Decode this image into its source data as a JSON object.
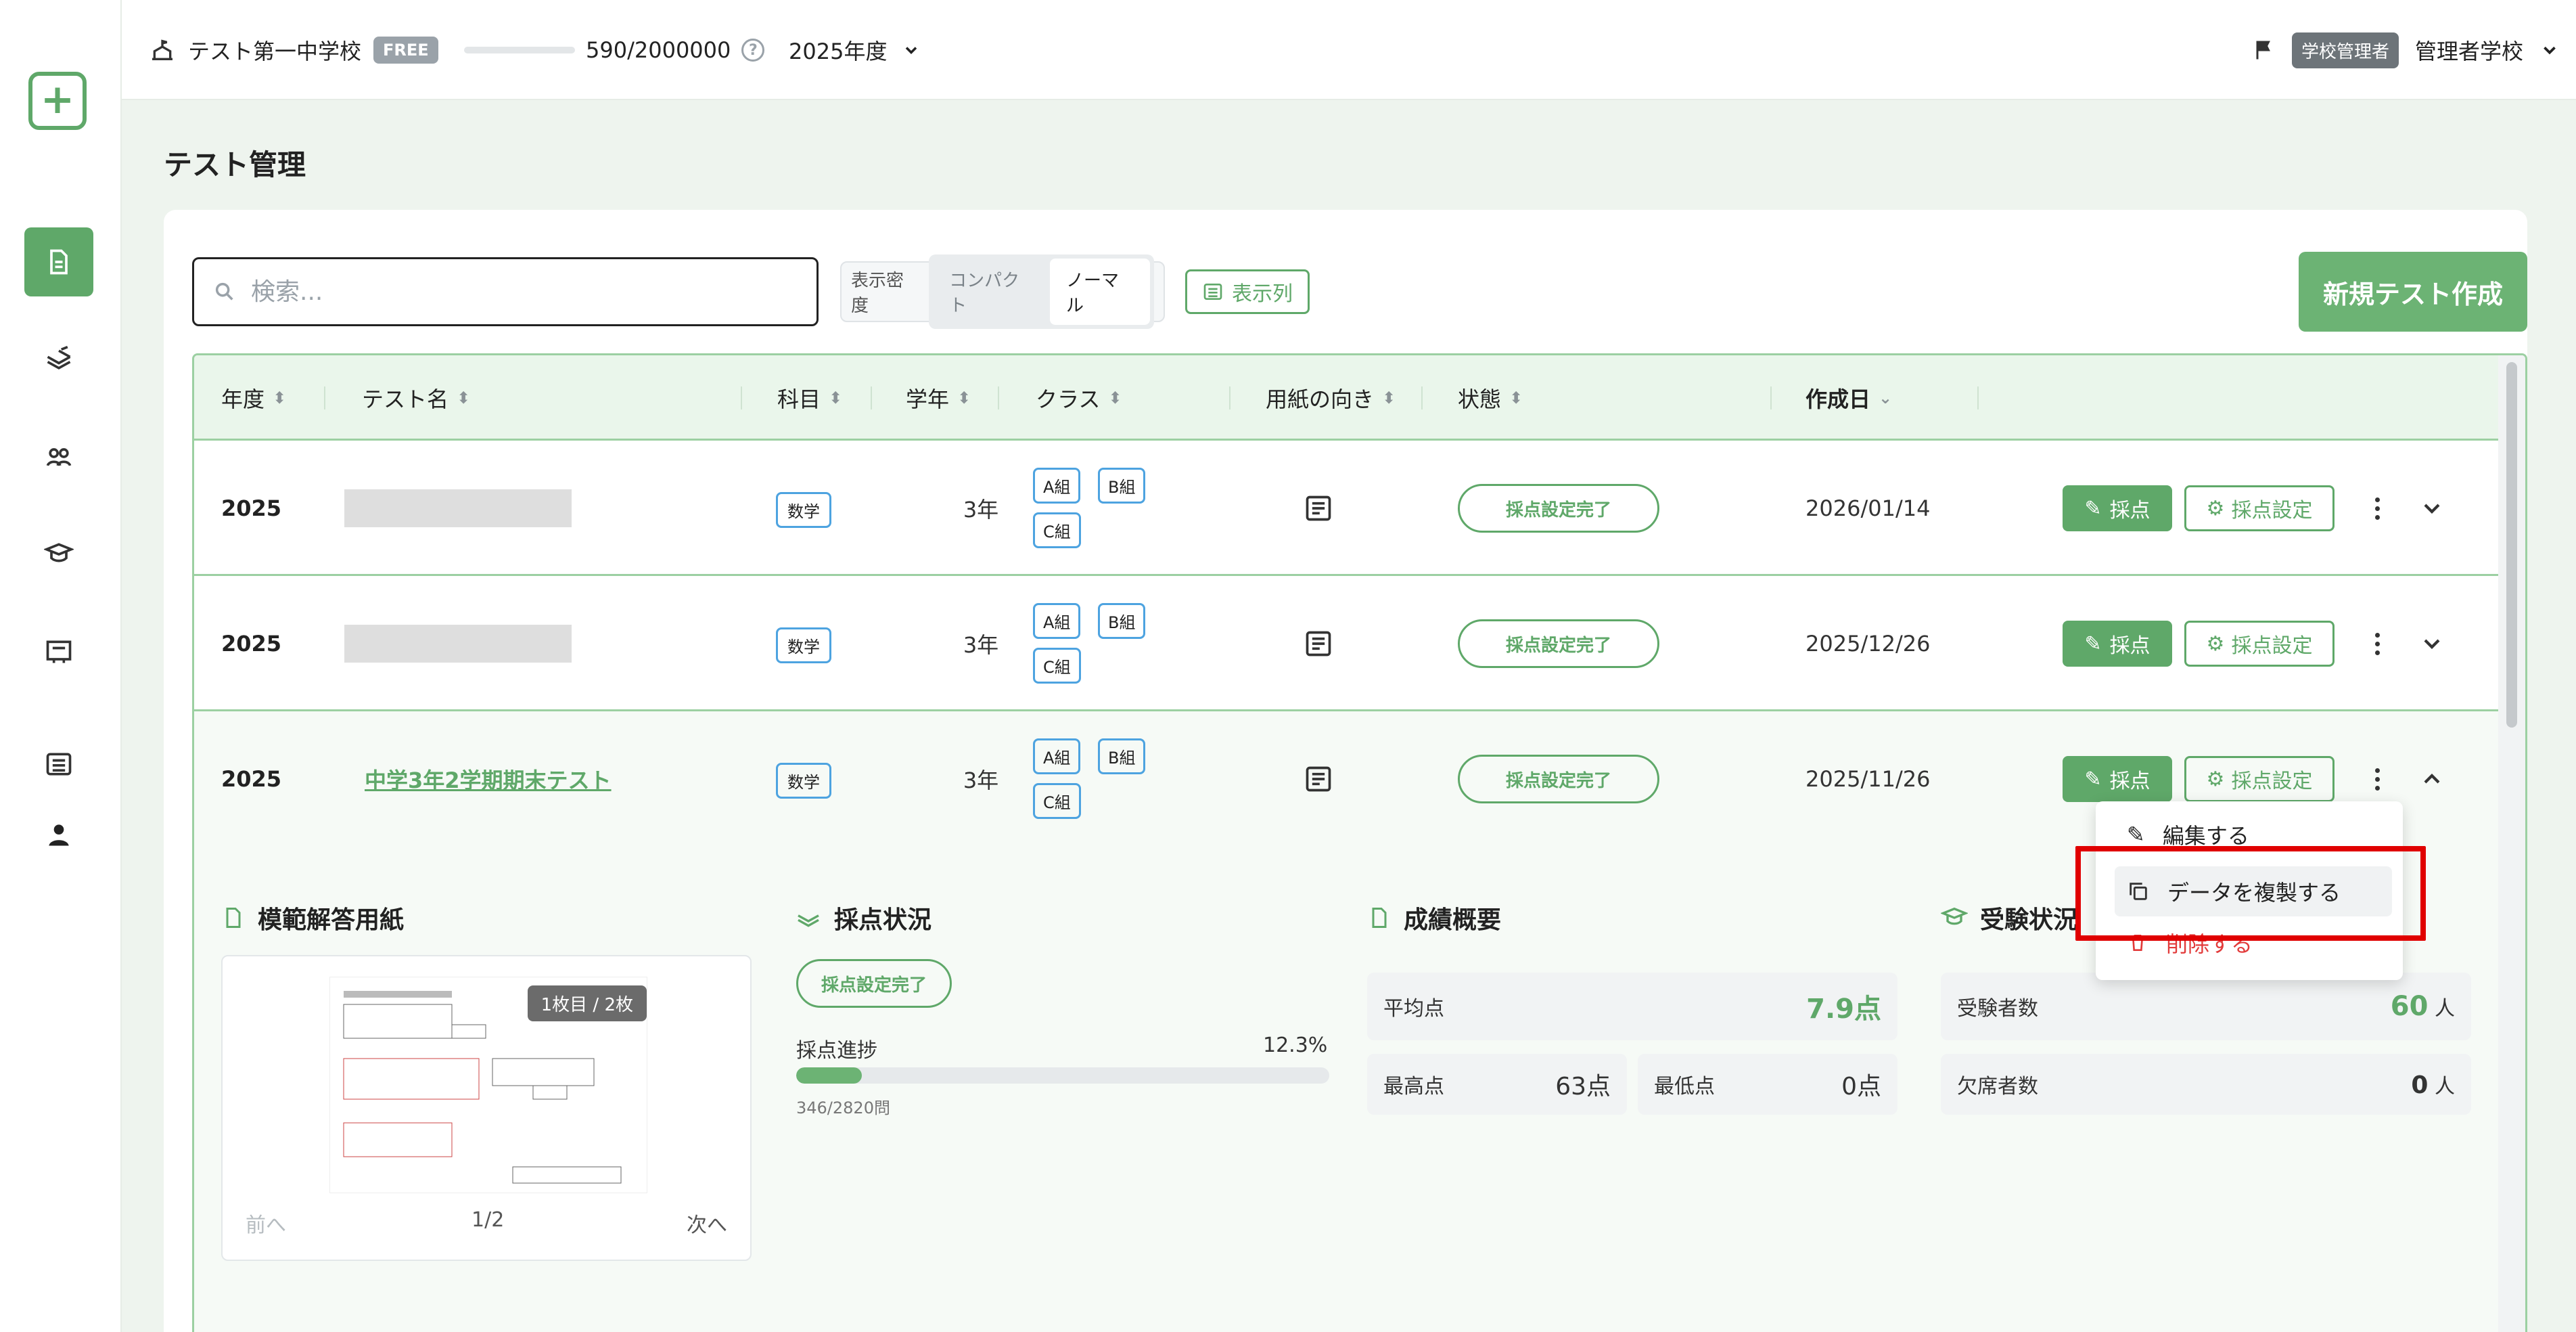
{
  "header": {
    "school_name": "テスト第一中学校",
    "plan_badge": "FREE",
    "storage": "590/2000000",
    "fiscal_year": "2025年度",
    "role_badge": "学校管理者",
    "user_name": "管理者学校"
  },
  "page": {
    "title": "テスト管理"
  },
  "toolbar": {
    "search_placeholder": "検索...",
    "density_label": "表示密度",
    "density_compact": "コンパクト",
    "density_normal": "ノーマル",
    "columns_button": "表示列",
    "new_test_button": "新規テスト作成"
  },
  "table": {
    "columns": [
      "年度",
      "テスト名",
      "科目",
      "学年",
      "クラス",
      "用紙の向き",
      "状態",
      "作成日"
    ],
    "rows": [
      {
        "year": "2025",
        "name": "",
        "subject": "数学",
        "grade": "3年",
        "classes": [
          "A組",
          "B組",
          "C組"
        ],
        "status": "採点設定完了",
        "date": "2026/01/14"
      },
      {
        "year": "2025",
        "name": "",
        "subject": "数学",
        "grade": "3年",
        "classes": [
          "A組",
          "B組",
          "C組"
        ],
        "status": "採点設定完了",
        "date": "2025/12/26"
      },
      {
        "year": "2025",
        "name": "中学3年2学期期末テスト",
        "subject": "数学",
        "grade": "3年",
        "classes": [
          "A組",
          "B組",
          "C組"
        ],
        "status": "採点設定完了",
        "date": "2025/11/26"
      }
    ],
    "grade_button": "採点",
    "grade_settings_button": "採点設定"
  },
  "detail": {
    "answer_sheet": {
      "title": "模範解答用紙",
      "page_badge": "1枚目 / 2枚",
      "prev": "前へ",
      "page": "1/2",
      "next": "次へ"
    },
    "grading": {
      "title": "採点状況",
      "status": "採点設定完了",
      "progress_label": "採点進捗",
      "progress_percent": "12.3%",
      "progress_value": 0.123,
      "progress_count": "346/2820問"
    },
    "scores": {
      "title": "成績概要",
      "avg_label": "平均点",
      "avg_value": "7.9点",
      "max_label": "最高点",
      "max_value": "63点",
      "min_label": "最低点",
      "min_value": "0点"
    },
    "attendance": {
      "title": "受験状況",
      "examinees_label": "受験者数",
      "examinees_value": "60",
      "absent_label": "欠席者数",
      "absent_value": "0",
      "unit": "人"
    }
  },
  "menu": {
    "edit": "編集する",
    "duplicate": "データを複製する",
    "delete": "削除する"
  },
  "colors": {
    "accent": "#5fa869",
    "class_border": "#4da3e0",
    "danger": "#e23a3a",
    "highlight": "#e00000"
  }
}
